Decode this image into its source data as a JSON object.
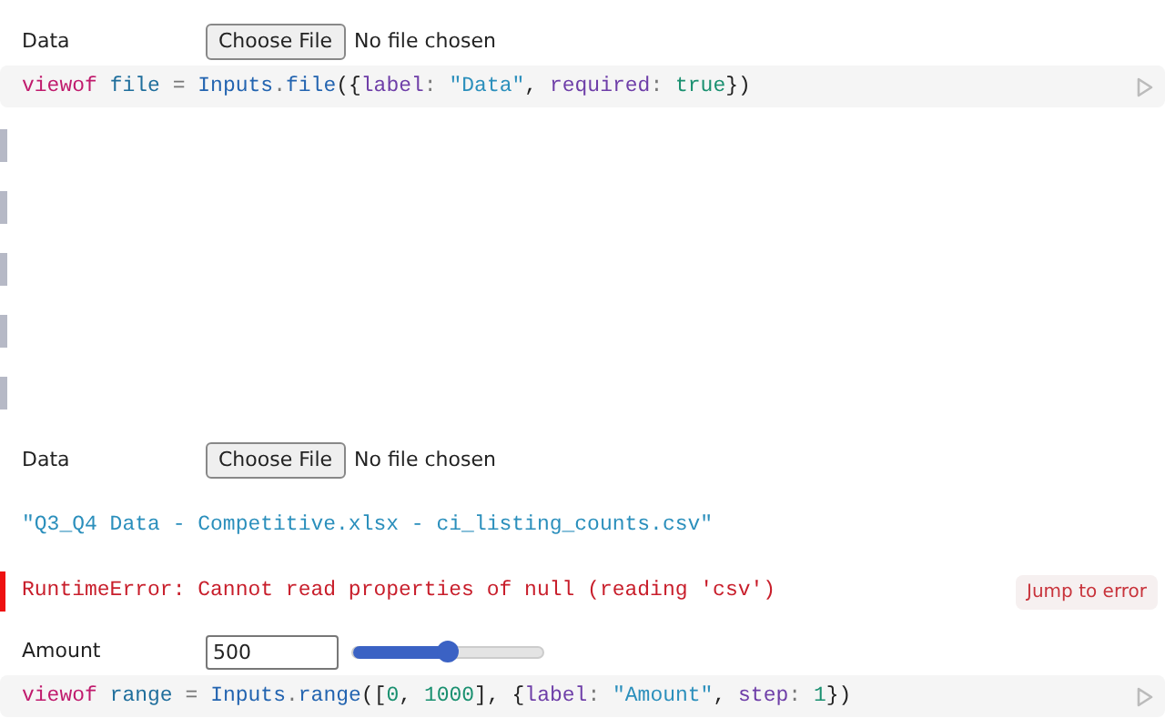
{
  "cells": [
    {
      "kind": "file_input",
      "label": "Data",
      "button": "Choose File",
      "status": "No file chosen",
      "code": "viewof file = Inputs.file({label: \"Data\", required: true})"
    },
    {
      "kind": "pending"
    },
    {
      "kind": "pending"
    },
    {
      "kind": "pending"
    },
    {
      "kind": "pending"
    },
    {
      "kind": "pending"
    },
    {
      "kind": "file_input",
      "label": "Data",
      "button": "Choose File",
      "status": "No file chosen"
    },
    {
      "kind": "string",
      "value": "\"Q3_Q4 Data - Competitive.xlsx - ci_listing_counts.csv\""
    },
    {
      "kind": "error",
      "message": "RuntimeError: Cannot read properties of null (reading 'csv')",
      "action": "Jump to error"
    },
    {
      "kind": "range",
      "label": "Amount",
      "value": "500",
      "level": 0.5,
      "code": "viewof range = Inputs.range([0, 1000], {label: \"Amount\", step: 1})"
    }
  ]
}
